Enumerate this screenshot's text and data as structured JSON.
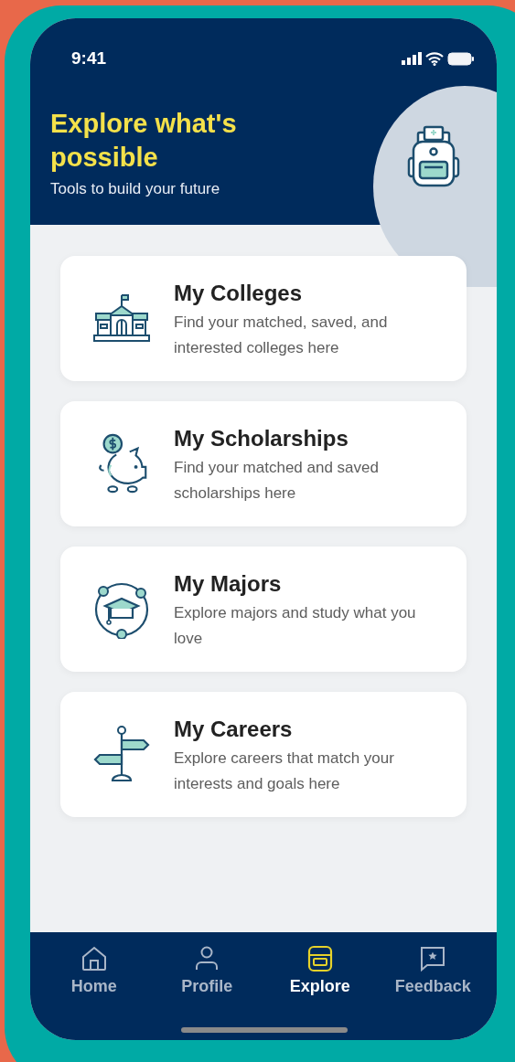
{
  "status_bar": {
    "time": "9:41"
  },
  "header": {
    "title": "Explore what's possible",
    "subtitle": "Tools to build your future"
  },
  "cards": [
    {
      "kind": "colleges",
      "title": "My Colleges",
      "description": "Find your matched, saved, and interested colleges here"
    },
    {
      "kind": "scholarships",
      "title": "My Scholarships",
      "description": "Find your matched and saved scholarships here"
    },
    {
      "kind": "majors",
      "title": "My Majors",
      "description": "Explore majors and study what you love"
    },
    {
      "kind": "careers",
      "title": "My Careers",
      "description": "Explore careers that match your interests and goals here"
    }
  ],
  "tab_bar": [
    {
      "kind": "home",
      "label": "Home",
      "selected": false
    },
    {
      "kind": "profile",
      "label": "Profile",
      "selected": false
    },
    {
      "kind": "explore",
      "label": "Explore",
      "selected": true
    },
    {
      "kind": "feedback",
      "label": "Feedback",
      "selected": false
    }
  ]
}
